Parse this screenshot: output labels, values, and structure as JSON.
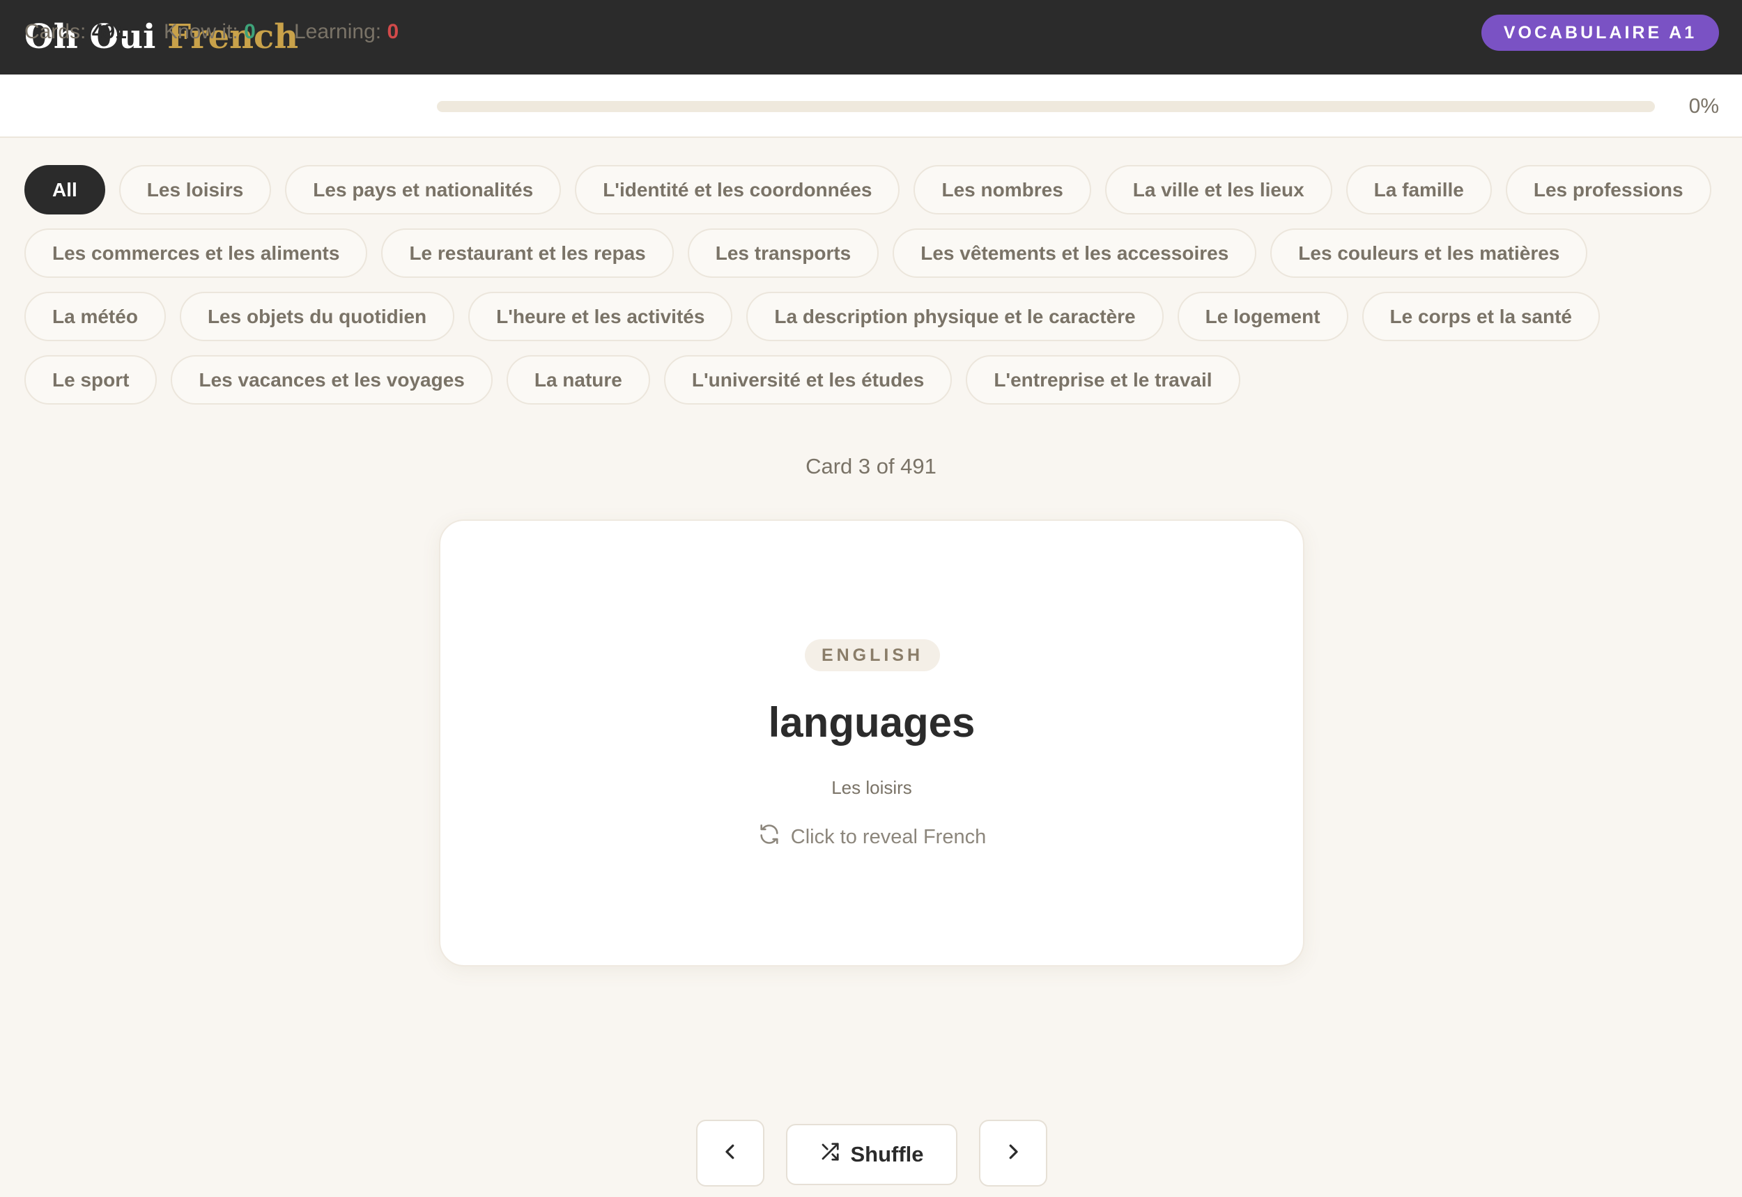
{
  "header": {
    "logo_main": "Oh Oui",
    "logo_accent": "French",
    "level_badge": "VOCABULAIRE A1",
    "accent_color": "#c9a24a",
    "badge_color": "#7a52c4"
  },
  "stats": {
    "cards_label": "Cards:",
    "cards_value": "491",
    "know_label": "Know it:",
    "know_value": "0",
    "learning_label": "Learning:",
    "learning_value": "0",
    "progress_fraction": 0,
    "progress_text": "0%"
  },
  "categories": [
    [
      "All",
      "Les loisirs",
      "Les pays et nationalités",
      "L'identité et les coordonnées",
      "Les nombres",
      "La ville et les lieux",
      "La famille",
      "Les professions"
    ],
    [
      "Les commerces et les aliments",
      "Le restaurant et les repas",
      "Les transports",
      "Les vêtements et les accessoires",
      "Les couleurs et les matières"
    ],
    [
      "La météo",
      "Les objets du quotidien",
      "L'heure et les activités",
      "La description physique et le caractère",
      "Le logement",
      "Le corps et la santé"
    ],
    [
      "Le sport",
      "Les vacances et les voyages",
      "La nature",
      "L'université et les études",
      "L'entreprise et le travail"
    ]
  ],
  "active_category": "All",
  "card": {
    "counter": "Card 3 of 491",
    "language_label": "ENGLISH",
    "term": "languages",
    "category": "Les loisirs",
    "hint": "Click to reveal French",
    "hint_icon": "refresh-icon"
  },
  "controls": {
    "prev_icon": "chevron-left-icon",
    "shuffle_label": "Shuffle",
    "shuffle_icon": "shuffle-icon",
    "next_icon": "chevron-right-icon"
  }
}
